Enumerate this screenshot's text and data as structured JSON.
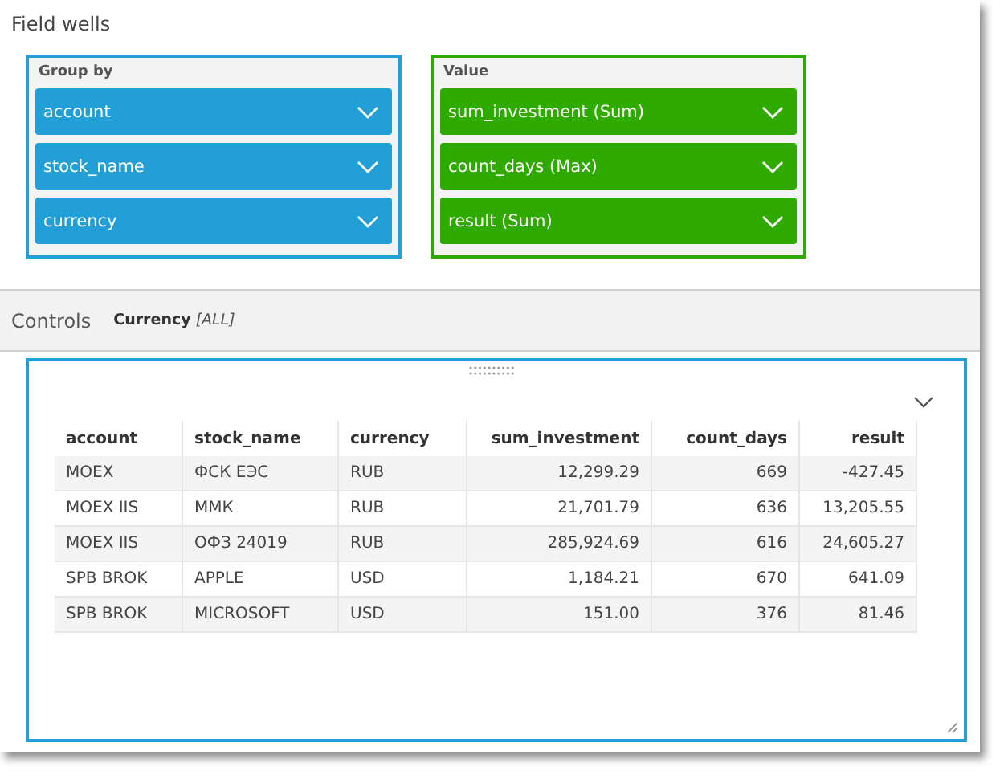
{
  "panel": {
    "title": "Field wells"
  },
  "wells": [
    {
      "label": "Group by",
      "color": "#239fd8",
      "fields": [
        "account",
        "stock_name",
        "currency"
      ]
    },
    {
      "label": "Value",
      "color": "#2eaa00",
      "fields": [
        "sum_investment (Sum)",
        "count_days (Max)",
        "result (Sum)"
      ]
    }
  ],
  "controls": {
    "title": "Controls",
    "filter_name": "Currency",
    "filter_value": "[ALL]"
  },
  "table": {
    "columns": [
      {
        "label": "account",
        "kind": "text"
      },
      {
        "label": "stock_name",
        "kind": "text"
      },
      {
        "label": "currency",
        "kind": "text"
      },
      {
        "label": "sum_investment",
        "kind": "number"
      },
      {
        "label": "count_days",
        "kind": "number"
      },
      {
        "label": "result",
        "kind": "number"
      }
    ],
    "rows": [
      [
        "MOEX",
        "ФСК ЕЭС",
        "RUB",
        "12,299.29",
        "669",
        "-427.45"
      ],
      [
        "MOEX IIS",
        "ММК",
        "RUB",
        "21,701.79",
        "636",
        "13,205.55"
      ],
      [
        "MOEX IIS",
        "ОФЗ 24019",
        "RUB",
        "285,924.69",
        "616",
        "24,605.27"
      ],
      [
        "SPB BROK",
        "APPLE",
        "USD",
        "1,184.21",
        "670",
        "641.09"
      ],
      [
        "SPB BROK",
        "MICROSOFT",
        "USD",
        "151.00",
        "376",
        "81.46"
      ]
    ]
  }
}
